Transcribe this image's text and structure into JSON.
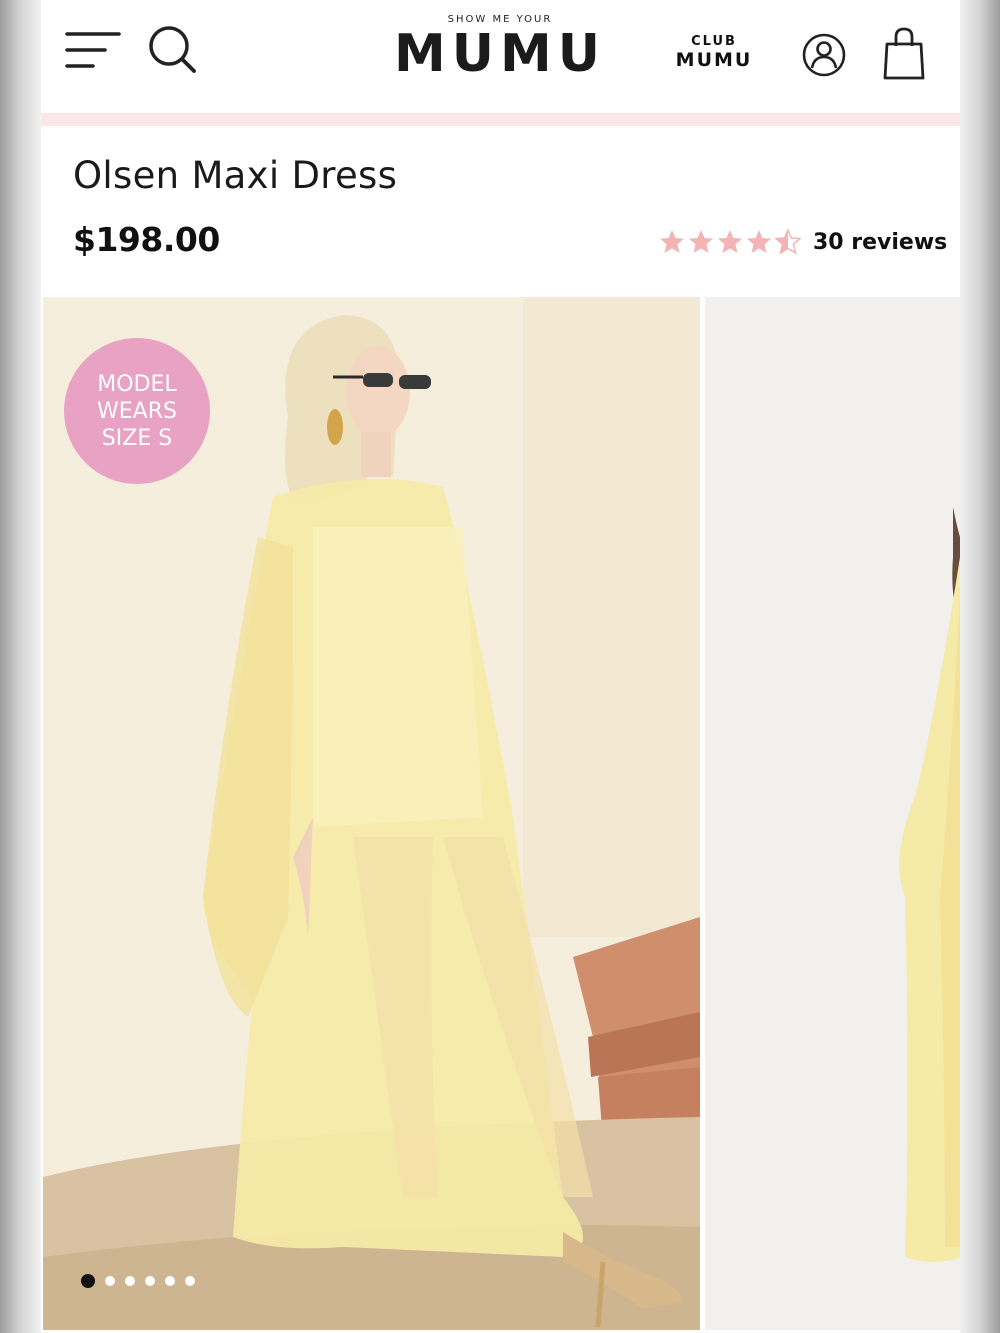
{
  "header": {
    "logo_small": "SHOW ME YOUR",
    "logo_big": "MUMU",
    "club_top": "CLUB",
    "club_bottom": "MUMU",
    "icons": [
      "menu-icon",
      "search-icon",
      "account-icon",
      "shopping-bag-icon"
    ]
  },
  "product": {
    "title": "Olsen Maxi Dress",
    "price": "$198.00",
    "rating": 4.5,
    "rating_max": 5,
    "reviews_label": "30 reviews"
  },
  "gallery": {
    "badge_text": "MODEL WEARS SIZE S",
    "slide_count": 6,
    "active_slide": 1
  },
  "colors": {
    "accent_pink_bar": "#fbe7ea",
    "badge_pink": "#e8a3c4",
    "star_pink": "#f2b4b4",
    "dress_yellow": "#f6ecb0"
  }
}
